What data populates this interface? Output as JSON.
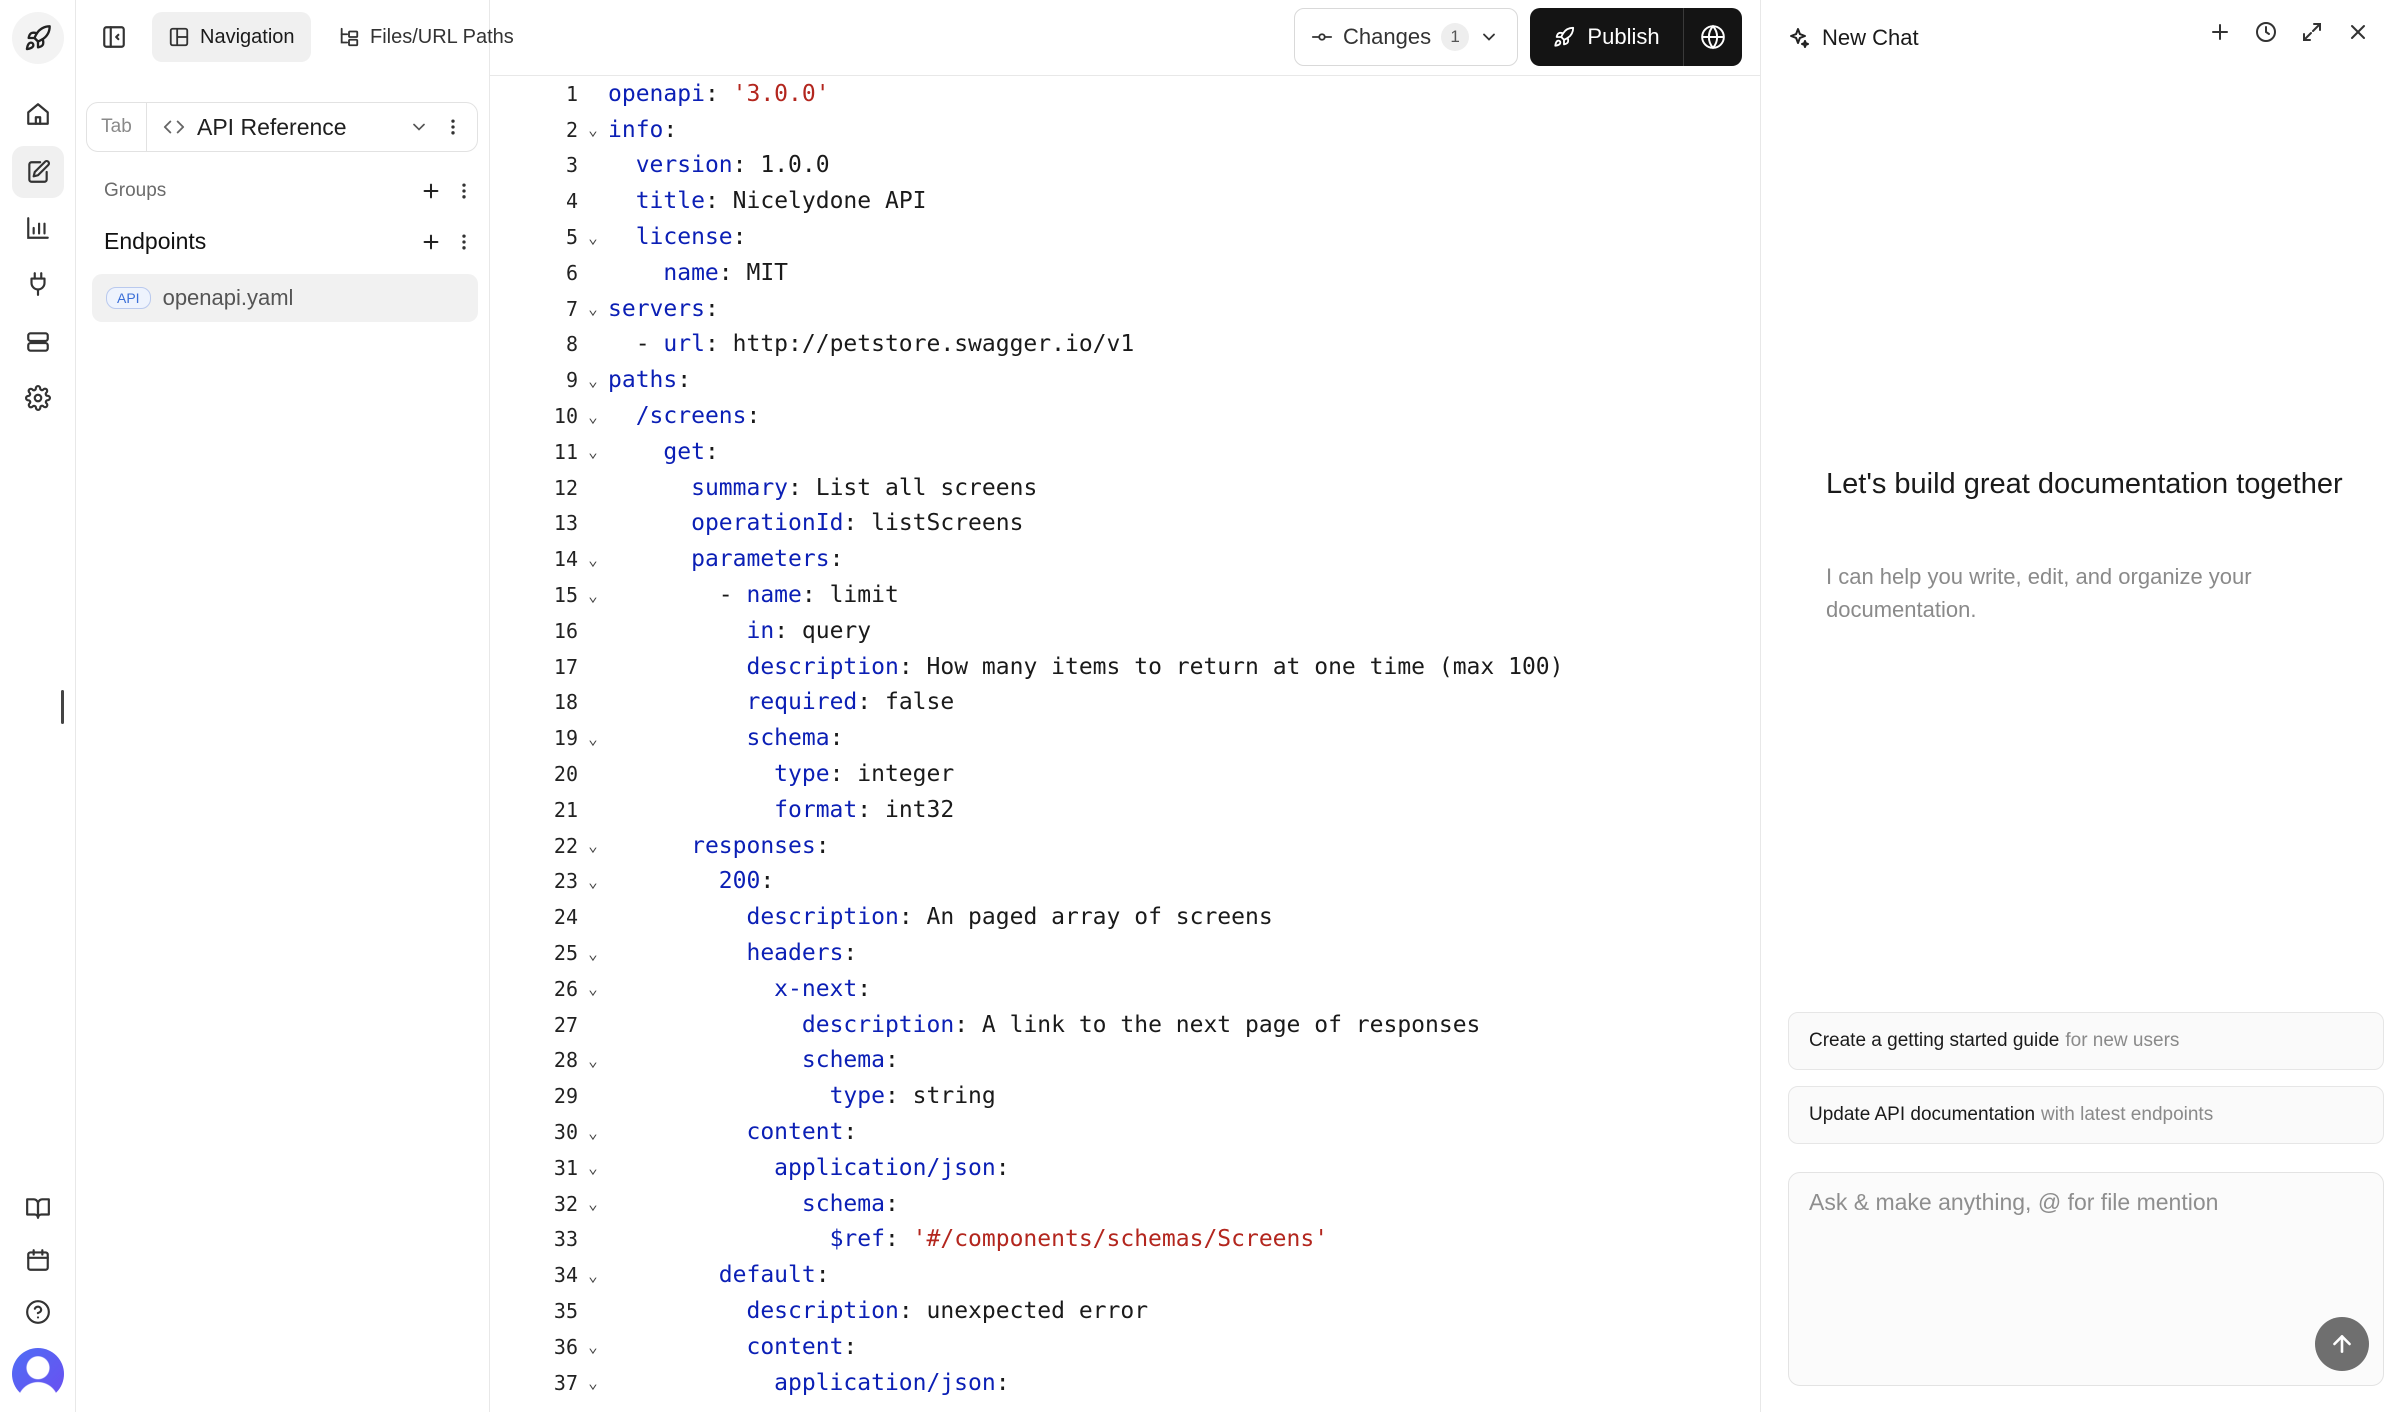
{
  "rail": {
    "items": [
      {
        "icon": "rocket-icon"
      },
      {
        "icon": "home-icon"
      },
      {
        "icon": "edit-icon",
        "active": true
      },
      {
        "icon": "analytics-icon"
      },
      {
        "icon": "plug-icon"
      },
      {
        "icon": "database-icon"
      },
      {
        "icon": "gear-icon"
      },
      {
        "icon": "book-icon"
      },
      {
        "icon": "calendar-icon"
      },
      {
        "icon": "help-icon"
      }
    ]
  },
  "top_tabs": {
    "navigation": "Navigation",
    "files": "Files/URL Paths"
  },
  "sidebar": {
    "tab_label": "Tab",
    "tab_value": "API Reference",
    "groups_label": "Groups",
    "endpoints_label": "Endpoints",
    "file_badge": "API",
    "file_name": "openapi.yaml"
  },
  "header": {
    "changes_label": "Changes",
    "changes_count": "1",
    "publish_label": "Publish"
  },
  "editor": {
    "lines": [
      {
        "n": "1",
        "indent": "",
        "fold": false,
        "key": "openapi",
        "sep": ": ",
        "val": "'3.0.0'",
        "str": true
      },
      {
        "n": "2",
        "indent": "",
        "fold": true,
        "key": "info",
        "sep": ":",
        "val": ""
      },
      {
        "n": "3",
        "indent": "  ",
        "fold": false,
        "key": "version",
        "sep": ": ",
        "val": "1.0.0"
      },
      {
        "n": "4",
        "indent": "  ",
        "fold": false,
        "key": "title",
        "sep": ": ",
        "val": "Nicelydone API"
      },
      {
        "n": "5",
        "indent": "  ",
        "fold": true,
        "key": "license",
        "sep": ":",
        "val": ""
      },
      {
        "n": "6",
        "indent": "    ",
        "fold": false,
        "key": "name",
        "sep": ": ",
        "val": "MIT"
      },
      {
        "n": "7",
        "indent": "",
        "fold": true,
        "key": "servers",
        "sep": ":",
        "val": ""
      },
      {
        "n": "8",
        "indent": "  - ",
        "fold": false,
        "key": "url",
        "sep": ": ",
        "val": "http://petstore.swagger.io/v1"
      },
      {
        "n": "9",
        "indent": "",
        "fold": true,
        "key": "paths",
        "sep": ":",
        "val": ""
      },
      {
        "n": "10",
        "indent": "  ",
        "fold": true,
        "key": "/screens",
        "sep": ":",
        "val": ""
      },
      {
        "n": "11",
        "indent": "    ",
        "fold": true,
        "key": "get",
        "sep": ":",
        "val": ""
      },
      {
        "n": "12",
        "indent": "      ",
        "fold": false,
        "key": "summary",
        "sep": ": ",
        "val": "List all screens"
      },
      {
        "n": "13",
        "indent": "      ",
        "fold": false,
        "key": "operationId",
        "sep": ": ",
        "val": "listScreens"
      },
      {
        "n": "14",
        "indent": "      ",
        "fold": true,
        "key": "parameters",
        "sep": ":",
        "val": ""
      },
      {
        "n": "15",
        "indent": "        - ",
        "fold": true,
        "key": "name",
        "sep": ": ",
        "val": "limit"
      },
      {
        "n": "16",
        "indent": "          ",
        "fold": false,
        "key": "in",
        "sep": ": ",
        "val": "query"
      },
      {
        "n": "17",
        "indent": "          ",
        "fold": false,
        "key": "description",
        "sep": ": ",
        "val": "How many items to return at one time (max 100)"
      },
      {
        "n": "18",
        "indent": "          ",
        "fold": false,
        "key": "required",
        "sep": ": ",
        "val": "false"
      },
      {
        "n": "19",
        "indent": "          ",
        "fold": true,
        "key": "schema",
        "sep": ":",
        "val": ""
      },
      {
        "n": "20",
        "indent": "            ",
        "fold": false,
        "key": "type",
        "sep": ": ",
        "val": "integer"
      },
      {
        "n": "21",
        "indent": "            ",
        "fold": false,
        "key": "format",
        "sep": ": ",
        "val": "int32"
      },
      {
        "n": "22",
        "indent": "      ",
        "fold": true,
        "key": "responses",
        "sep": ":",
        "val": ""
      },
      {
        "n": "23",
        "indent": "        ",
        "fold": true,
        "key": "200",
        "sep": ":",
        "val": ""
      },
      {
        "n": "24",
        "indent": "          ",
        "fold": false,
        "key": "description",
        "sep": ": ",
        "val": "An paged array of screens"
      },
      {
        "n": "25",
        "indent": "          ",
        "fold": true,
        "key": "headers",
        "sep": ":",
        "val": ""
      },
      {
        "n": "26",
        "indent": "            ",
        "fold": true,
        "key": "x-next",
        "sep": ":",
        "val": ""
      },
      {
        "n": "27",
        "indent": "              ",
        "fold": false,
        "key": "description",
        "sep": ": ",
        "val": "A link to the next page of responses"
      },
      {
        "n": "28",
        "indent": "              ",
        "fold": true,
        "key": "schema",
        "sep": ":",
        "val": ""
      },
      {
        "n": "29",
        "indent": "                ",
        "fold": false,
        "key": "type",
        "sep": ": ",
        "val": "string"
      },
      {
        "n": "30",
        "indent": "          ",
        "fold": true,
        "key": "content",
        "sep": ":",
        "val": ""
      },
      {
        "n": "31",
        "indent": "            ",
        "fold": true,
        "key": "application/json",
        "sep": ":",
        "val": ""
      },
      {
        "n": "32",
        "indent": "              ",
        "fold": true,
        "key": "schema",
        "sep": ":",
        "val": ""
      },
      {
        "n": "33",
        "indent": "                ",
        "fold": false,
        "key": "$ref",
        "sep": ": ",
        "val": "'#/components/schemas/Screens'",
        "str": true
      },
      {
        "n": "34",
        "indent": "        ",
        "fold": true,
        "key": "default",
        "sep": ":",
        "val": ""
      },
      {
        "n": "35",
        "indent": "          ",
        "fold": false,
        "key": "description",
        "sep": ": ",
        "val": "unexpected error"
      },
      {
        "n": "36",
        "indent": "          ",
        "fold": true,
        "key": "content",
        "sep": ":",
        "val": ""
      },
      {
        "n": "37",
        "indent": "            ",
        "fold": true,
        "key": "application/json",
        "sep": ":",
        "val": ""
      }
    ]
  },
  "chat": {
    "title": "New Chat",
    "welcome_title": "Let's build great documentation together",
    "welcome_sub": "I can help you write, edit, and organize your documentation.",
    "suggestions": [
      {
        "strong": "Create a getting started guide",
        "muted": "for new users"
      },
      {
        "strong": "Update API documentation",
        "muted": "with latest endpoints"
      }
    ],
    "input_placeholder": "Ask & make anything, @ for file mention"
  },
  "colors": {
    "key": "#0b1fb5",
    "string": "#b3261e",
    "publish_bg": "#141414"
  }
}
